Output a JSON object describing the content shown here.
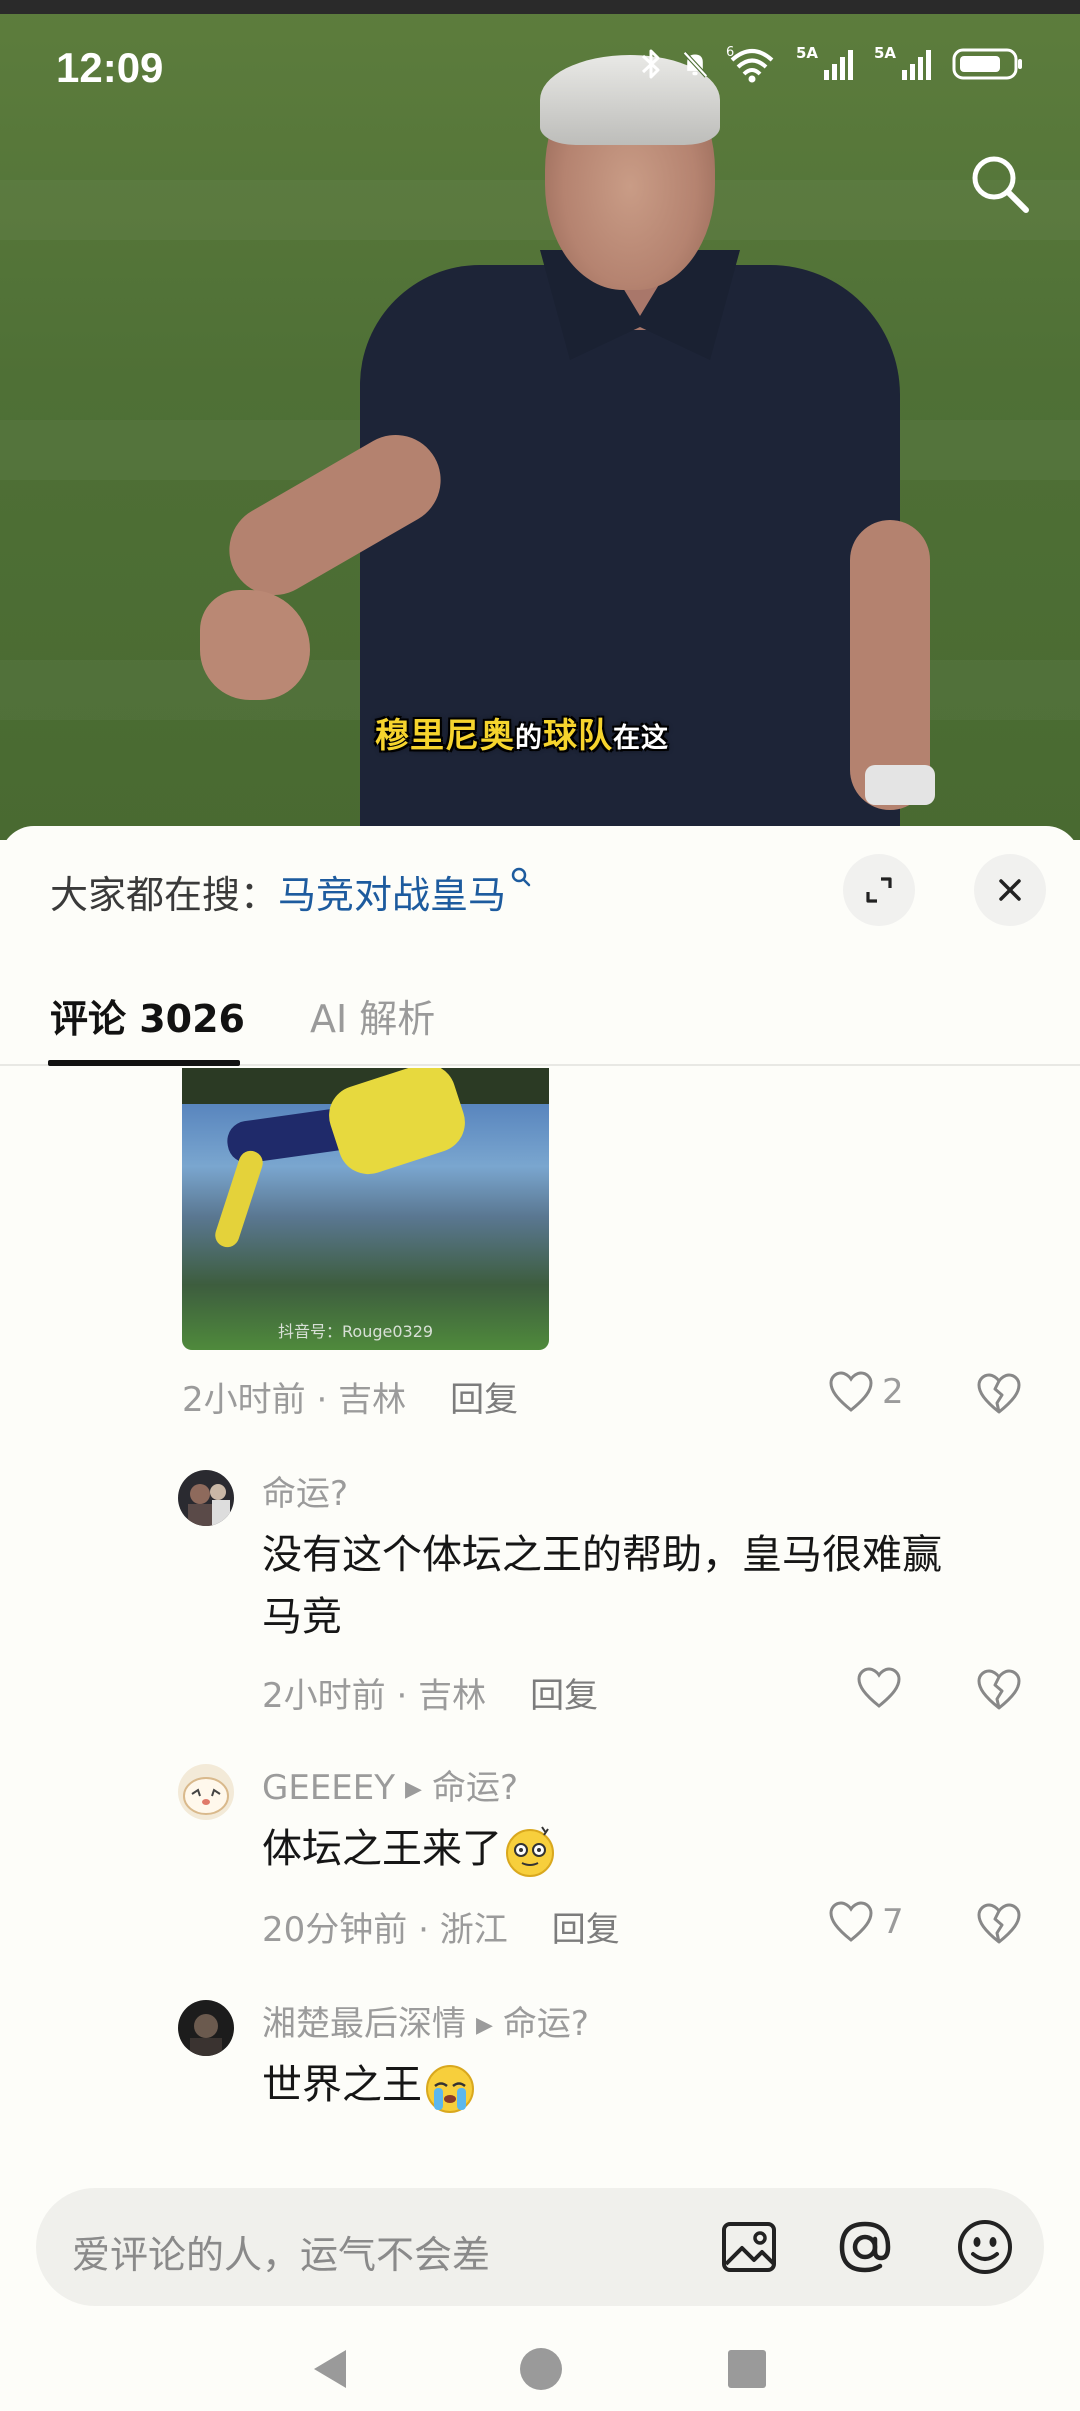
{
  "status_bar": {
    "time": "12:09",
    "signal_1": "5A",
    "signal_2": "5A",
    "wifi_badge": "6"
  },
  "video": {
    "subtitle_part1": "穆里尼奥",
    "subtitle_part2": "的",
    "subtitle_part3": "球队",
    "subtitle_part4": "在这",
    "subtitle_color": "#f6d42d"
  },
  "hot_search": {
    "prefix": "大家都在搜：",
    "keyword": "马竞对战皇马"
  },
  "tabs": [
    {
      "label": "评论 3026",
      "active": true
    },
    {
      "label": "AI 解析",
      "active": false
    }
  ],
  "comments": [
    {
      "image_watermark": "抖音号：Rouge0329",
      "time": "2小时前",
      "location": "吉林",
      "reply_label": "回复",
      "likes": "2"
    },
    {
      "author": "命运?",
      "text_line1": "没有这个体坛之王的帮助，皇马很难赢",
      "text_line2": "马竞",
      "time": "2小时前",
      "location": "吉林",
      "reply_label": "回复",
      "likes": ""
    },
    {
      "author": "GEEEEY",
      "reply_to": "命运?",
      "text": "体坛之王来了",
      "emoji": "dizzy-face-emoji",
      "time": "20分钟前",
      "location": "浙江",
      "reply_label": "回复",
      "likes": "7"
    },
    {
      "author": "湘楚最后深情",
      "reply_to": "命运?",
      "text": "世界之王",
      "emoji": "crying-face-emoji"
    }
  ],
  "input": {
    "placeholder": "爱评论的人，运气不会差"
  },
  "colors": {
    "keyword": "#1d5b9e",
    "meta": "#9b9b9b",
    "text": "#161616"
  }
}
